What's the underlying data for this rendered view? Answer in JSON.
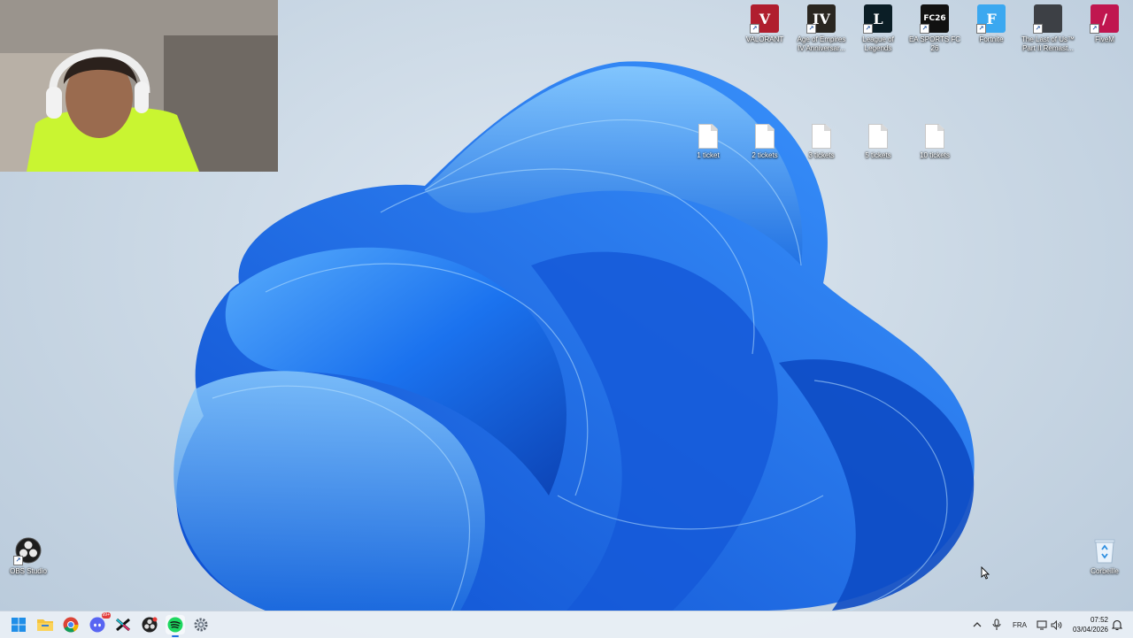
{
  "desktop": {
    "top_shortcuts": [
      {
        "label": "VALORANT",
        "icon": "valorant-icon",
        "color": "#b01e2e",
        "glyph": "V"
      },
      {
        "label": "Age of Empires IV Anniversar...",
        "icon": "age-of-empires-icon",
        "color": "#2a2620",
        "glyph": "IV"
      },
      {
        "label": "League of Legends",
        "icon": "league-of-legends-icon",
        "color": "#0b1e26",
        "glyph": "L"
      },
      {
        "label": "EA SPORTS FC 26",
        "icon": "ea-sports-fc-icon",
        "color": "#111111",
        "glyph": "FC26"
      },
      {
        "label": "Fortnite",
        "icon": "fortnite-icon",
        "color": "#3ba8f0",
        "glyph": "F"
      },
      {
        "label": "The Last of Us™ Part II Remast...",
        "icon": "the-last-of-us-icon",
        "color": "#3d4045",
        "glyph": ""
      },
      {
        "label": "FiveM",
        "icon": "fivem-icon",
        "color": "#c0164f",
        "glyph": "/"
      }
    ],
    "files": [
      {
        "label": "1 ticket",
        "icon": "file-icon"
      },
      {
        "label": "2 tickets",
        "icon": "file-icon"
      },
      {
        "label": "3 tickets",
        "icon": "file-icon"
      },
      {
        "label": "5 tickets",
        "icon": "file-icon"
      },
      {
        "label": "10 tickets",
        "icon": "file-icon"
      }
    ],
    "obs": {
      "label": "OBS Studio",
      "icon": "obs-icon"
    },
    "recycle_bin": {
      "label": "Corbeille",
      "icon": "recycle-bin-icon"
    }
  },
  "taskbar": {
    "apps": [
      {
        "name": "start",
        "icon": "windows-start-icon"
      },
      {
        "name": "file-explorer",
        "icon": "folder-icon"
      },
      {
        "name": "chrome",
        "icon": "chrome-icon"
      },
      {
        "name": "discord",
        "icon": "discord-icon",
        "badge": "99+"
      },
      {
        "name": "capcut",
        "icon": "capcut-icon"
      },
      {
        "name": "obs",
        "icon": "obs-icon"
      },
      {
        "name": "spotify",
        "icon": "spotify-icon"
      },
      {
        "name": "settings",
        "icon": "gear-icon"
      }
    ],
    "tray": {
      "language": "FRA",
      "time": "07:52",
      "date": "03/04/2026"
    }
  },
  "colors": {
    "accent": "#1f6fe0",
    "wallpaper_blue": "#1766e0"
  }
}
